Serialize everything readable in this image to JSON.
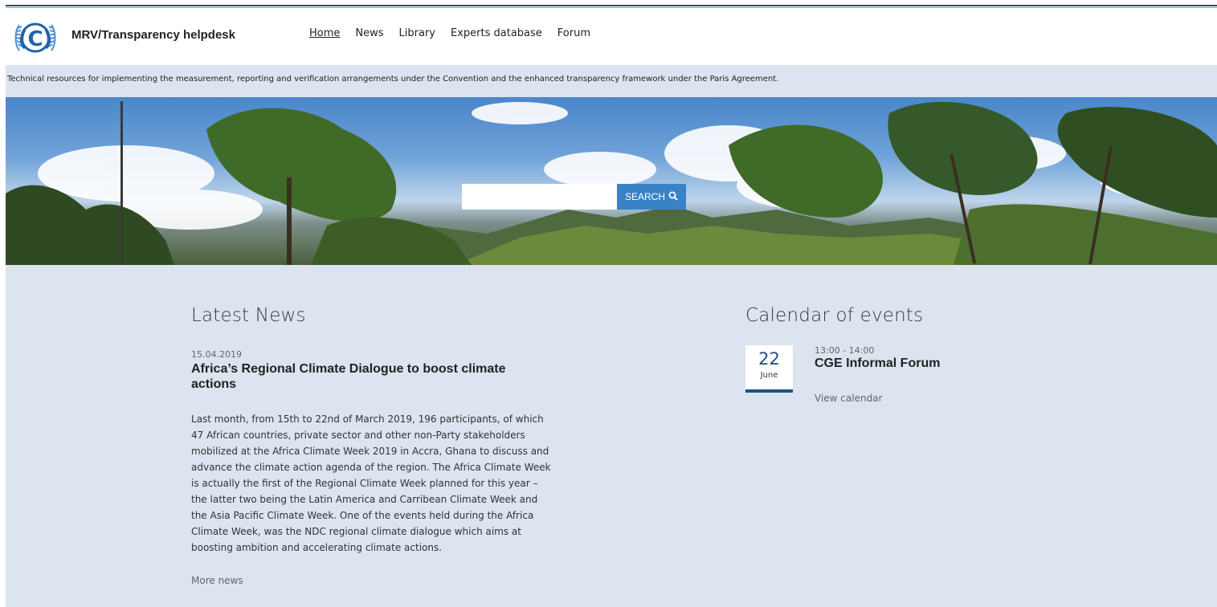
{
  "header": {
    "site_title": "MRV/Transparency helpdesk",
    "nav": [
      {
        "label": "Home",
        "active": true
      },
      {
        "label": "News",
        "active": false
      },
      {
        "label": "Library",
        "active": false
      },
      {
        "label": "Experts database",
        "active": false
      },
      {
        "label": "Forum",
        "active": false
      }
    ],
    "logo_icon": "un-climate-change-emblem",
    "logo_text": "(C)"
  },
  "tagline": "Technical resources for implementing the measurement, reporting and verification arrangements under the Convention and the enhanced transparency framework under the Paris Agreement.",
  "search": {
    "placeholder": "",
    "value": "",
    "button_label": "SEARCH",
    "button_icon": "magnifier-icon"
  },
  "news": {
    "heading": "Latest News",
    "date": "15.04.2019",
    "title": "Africa’s Regional Climate Dialogue to boost climate actions",
    "body": "Last month, from 15th to 22nd of March 2019, 196 participants, of which 47 African countries, private sector and other non-Party stakeholders mobilized at the Africa Climate Week 2019 in Accra, Ghana to discuss and advance the climate action agenda of the region. The Africa Climate Week is actually the first of the Regional Climate Week planned for this year – the latter two being the Latin America and Carribean Climate Week and the Asia Pacific Climate Week. One of the events held during the Africa Climate Week, was the NDC regional climate dialogue which aims at boosting ambition and accelerating climate actions.",
    "more_link": "More news"
  },
  "calendar": {
    "heading": "Calendar of events",
    "event": {
      "day": "22",
      "month": "June",
      "time": "13:00 - 14:00",
      "title": "CGE Informal Forum"
    },
    "view_link": "View calendar"
  },
  "colors": {
    "accent": "#3a82c6",
    "date_accent": "#1d4f8a",
    "band_bg": "#dbe4ef"
  }
}
